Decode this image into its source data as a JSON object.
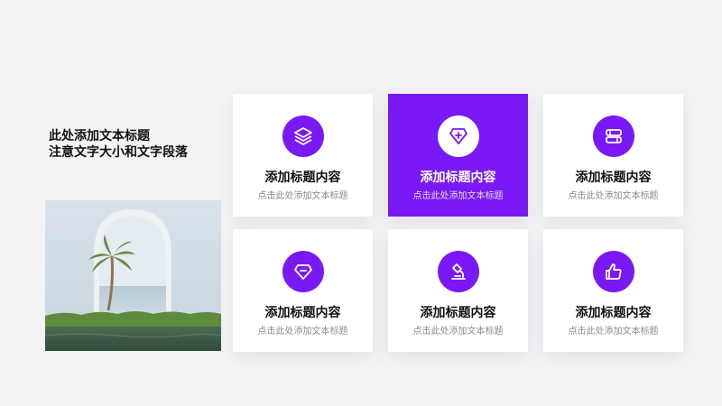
{
  "heading": {
    "line1": "此处添加文本标题",
    "line2": "注意文字大小和文字段落"
  },
  "colors": {
    "accent": "#7a18f6",
    "background": "#f3f3f4",
    "card": "#ffffff"
  },
  "cards": [
    {
      "icon": "layers-icon",
      "title": "添加标题内容",
      "subtitle": "点击此处添加文本标题"
    },
    {
      "icon": "diamond-plus-icon",
      "title": "添加标题内容",
      "subtitle": "点击此处添加文本标题"
    },
    {
      "icon": "stacked-books-icon",
      "title": "添加标题内容",
      "subtitle": "点击此处添加文本标题"
    },
    {
      "icon": "gem-icon",
      "title": "添加标题内容",
      "subtitle": "点击此处添加文本标题"
    },
    {
      "icon": "microscope-icon",
      "title": "添加标题内容",
      "subtitle": "点击此处添加文本标题"
    },
    {
      "icon": "thumbs-up-icon",
      "title": "添加标题内容",
      "subtitle": "点击此处添加文本标题"
    }
  ]
}
